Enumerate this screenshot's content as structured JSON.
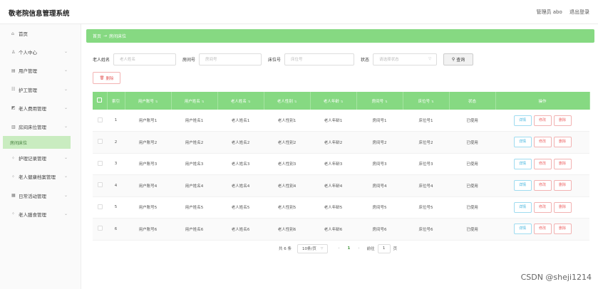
{
  "app_title": "敬老院信息管理系统",
  "top_right": {
    "user": "管理员 abo",
    "logout": "退出登录"
  },
  "sidebar": {
    "items": [
      {
        "icon": "home-icon",
        "glyph": "⌂",
        "label": "首页",
        "chevron": false
      },
      {
        "icon": "user-icon",
        "glyph": "♙",
        "label": "个人中心",
        "chevron": true
      },
      {
        "icon": "users-icon",
        "glyph": "▤",
        "label": "用户管理",
        "chevron": true
      },
      {
        "icon": "nurse-icon",
        "glyph": "☷",
        "label": "护工管理",
        "chevron": true
      },
      {
        "icon": "fee-icon",
        "glyph": "◩",
        "label": "老人费用管理",
        "chevron": true
      },
      {
        "icon": "bed-icon",
        "glyph": "▥",
        "label": "房间床位管理",
        "chevron": true
      }
    ],
    "sub_active": "房间床位",
    "items2": [
      {
        "icon": "care-icon",
        "glyph": "⁘",
        "label": "护理记录管理",
        "chevron": true
      },
      {
        "icon": "health-icon",
        "glyph": "⁘",
        "label": "老人健康档案管理",
        "chevron": true
      },
      {
        "icon": "activity-icon",
        "glyph": "▦",
        "label": "日常活动管理",
        "chevron": true
      },
      {
        "icon": "meal-icon",
        "glyph": "⁘",
        "label": "老人膳食管理",
        "chevron": true
      }
    ]
  },
  "breadcrumb": {
    "home": "首页",
    "sep": "→",
    "current": "房间床位"
  },
  "filters": {
    "name_label": "老人姓名",
    "name_placeholder": "老人姓名",
    "room_label": "房间号",
    "room_placeholder": "房间号",
    "bed_label": "床位号",
    "bed_placeholder": "床位号",
    "status_label": "状态",
    "status_placeholder": "请选择状态",
    "query_label": "查询"
  },
  "delete_button": "删除",
  "table": {
    "headers": [
      "索引",
      "用户账号",
      "用户姓名",
      "老人姓名",
      "老人性别",
      "老人年龄",
      "房间号",
      "床位号",
      "状态",
      "操作"
    ],
    "rows": [
      [
        "1",
        "用户账号1",
        "用户姓名1",
        "老人姓名1",
        "老人性别1",
        "老人年龄1",
        "房间号1",
        "床位号1",
        "已使用"
      ],
      [
        "2",
        "用户账号2",
        "用户姓名2",
        "老人姓名2",
        "老人性别2",
        "老人年龄2",
        "房间号2",
        "床位号2",
        "已使用"
      ],
      [
        "3",
        "用户账号3",
        "用户姓名3",
        "老人姓名3",
        "老人性别3",
        "老人年龄3",
        "房间号3",
        "床位号3",
        "已使用"
      ],
      [
        "4",
        "用户账号4",
        "用户姓名4",
        "老人姓名4",
        "老人性别4",
        "老人年龄4",
        "房间号4",
        "床位号4",
        "已使用"
      ],
      [
        "5",
        "用户账号5",
        "用户姓名5",
        "老人姓名5",
        "老人性别5",
        "老人年龄5",
        "房间号5",
        "床位号5",
        "已使用"
      ],
      [
        "6",
        "用户账号6",
        "用户姓名6",
        "老人姓名6",
        "老人性别6",
        "老人年龄6",
        "房间号6",
        "床位号6",
        "已使用"
      ]
    ],
    "actions": {
      "detail": "详情",
      "edit": "修改",
      "delete": "删除"
    }
  },
  "pager": {
    "total": "共 6 条",
    "size": "10条/页",
    "current": "1",
    "goto": "前往",
    "goto_value": "1",
    "unit": "页"
  },
  "watermark": "CSDN @sheji1214",
  "colors": {
    "accent": "#86d982",
    "danger": "#e66",
    "info": "#3cb2dc"
  }
}
